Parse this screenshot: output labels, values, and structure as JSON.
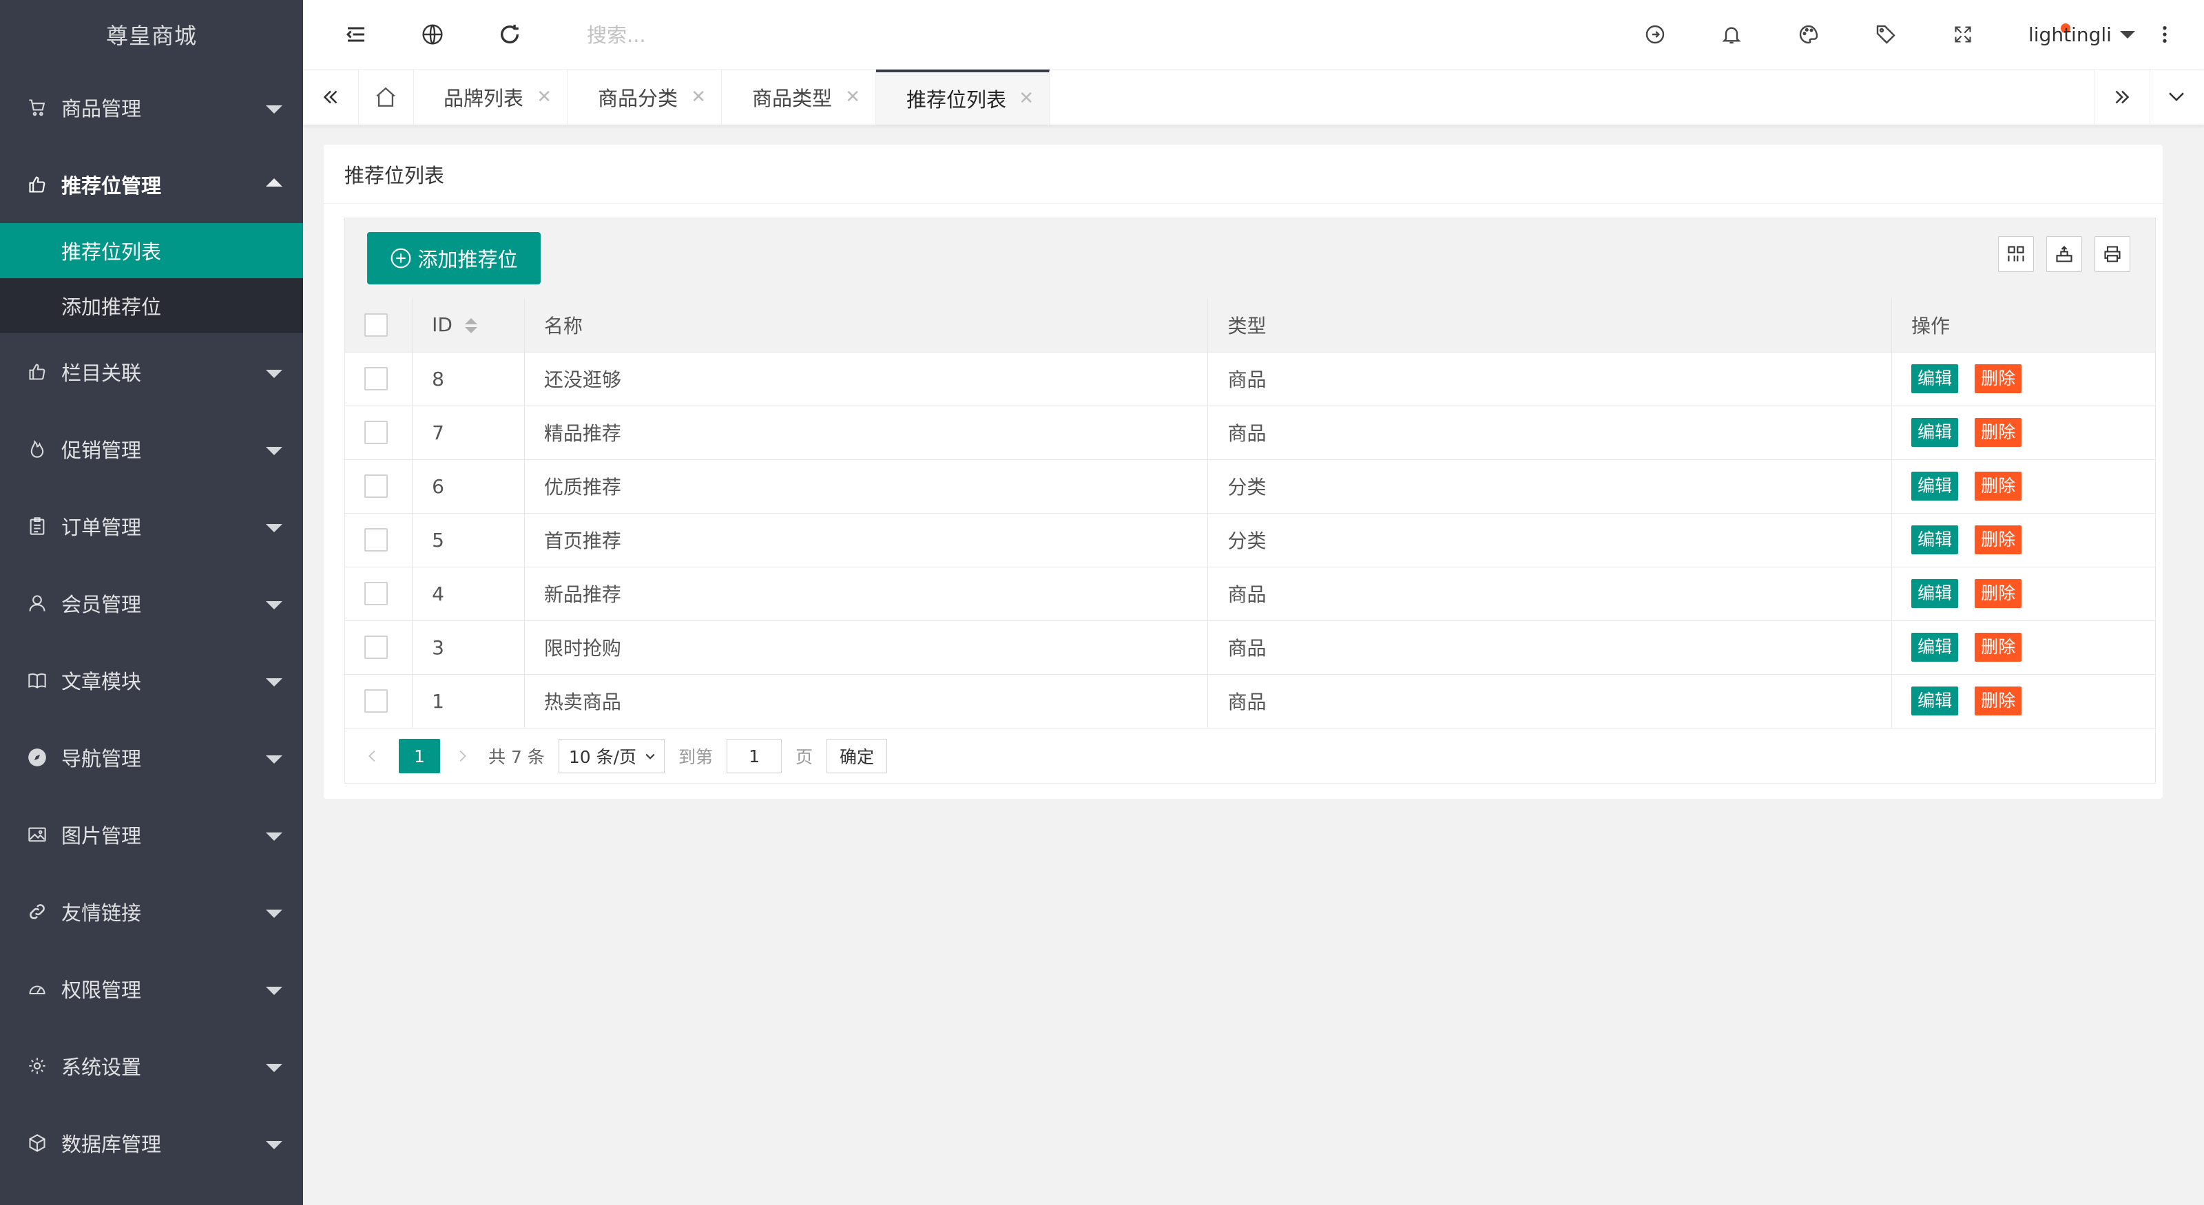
{
  "sidebar": {
    "logo": "尊皇商城",
    "menu": [
      {
        "label": "商品管理",
        "icon": "cart-icon",
        "expanded": false
      },
      {
        "label": "推荐位管理",
        "icon": "thumbs-up-icon",
        "expanded": true
      },
      {
        "label": "栏目关联",
        "icon": "thumbs-up-icon",
        "expanded": false
      },
      {
        "label": "促销管理",
        "icon": "fire-icon",
        "expanded": false
      },
      {
        "label": "订单管理",
        "icon": "clipboard-icon",
        "expanded": false
      },
      {
        "label": "会员管理",
        "icon": "user-icon",
        "expanded": false
      },
      {
        "label": "文章模块",
        "icon": "book-icon",
        "expanded": false
      },
      {
        "label": "导航管理",
        "icon": "compass-icon",
        "expanded": false
      },
      {
        "label": "图片管理",
        "icon": "picture-icon",
        "expanded": false
      },
      {
        "label": "友情链接",
        "icon": "link-icon",
        "expanded": false
      },
      {
        "label": "权限管理",
        "icon": "dashboard-icon",
        "expanded": false
      },
      {
        "label": "系统设置",
        "icon": "gear-icon",
        "expanded": false
      },
      {
        "label": "数据库管理",
        "icon": "database-icon",
        "expanded": false
      }
    ],
    "submenu": [
      {
        "label": "推荐位列表",
        "active": true
      },
      {
        "label": "添加推荐位",
        "active": false
      }
    ]
  },
  "header": {
    "search_placeholder": "搜索...",
    "username": "lightingli"
  },
  "tabs": [
    {
      "label": "品牌列表",
      "active": false
    },
    {
      "label": "商品分类",
      "active": false
    },
    {
      "label": "商品类型",
      "active": false
    },
    {
      "label": "推荐位列表",
      "active": true
    }
  ],
  "card": {
    "title": "推荐位列表",
    "add_button": "添加推荐位"
  },
  "table": {
    "headers": {
      "id": "ID",
      "name": "名称",
      "type": "类型",
      "ops": "操作"
    },
    "edit_label": "编辑",
    "delete_label": "删除",
    "rows": [
      {
        "id": "8",
        "name": "还没逛够",
        "type": "商品"
      },
      {
        "id": "7",
        "name": "精品推荐",
        "type": "商品"
      },
      {
        "id": "6",
        "name": "优质推荐",
        "type": "分类"
      },
      {
        "id": "5",
        "name": "首页推荐",
        "type": "分类"
      },
      {
        "id": "4",
        "name": "新品推荐",
        "type": "商品"
      },
      {
        "id": "3",
        "name": "限时抢购",
        "type": "商品"
      },
      {
        "id": "1",
        "name": "热卖商品",
        "type": "商品"
      }
    ]
  },
  "pager": {
    "current": "1",
    "total": "共 7 条",
    "page_size": "10 条/页",
    "goto_label": "到第",
    "goto_value": "1",
    "page_label": "页",
    "confirm": "确定"
  },
  "colors": {
    "sidebar_bg": "#393d49",
    "accent": "#009688",
    "danger": "#ff5722"
  }
}
